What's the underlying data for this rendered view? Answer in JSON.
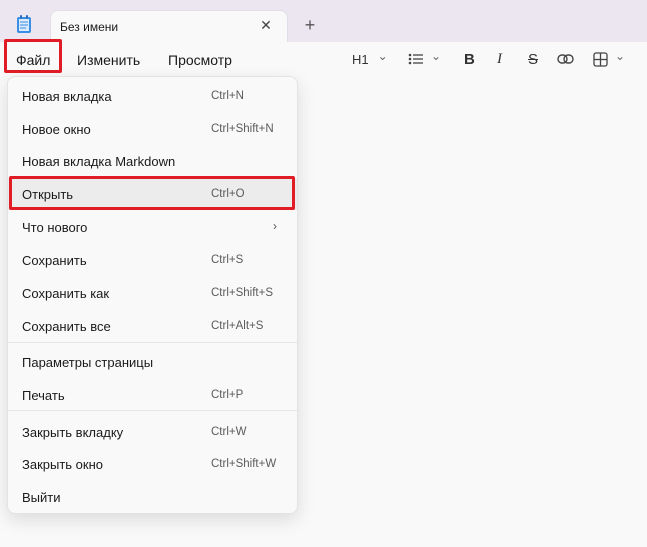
{
  "window": {
    "tab_title": "Без имени",
    "tab_close": "✕",
    "new_tab": "+"
  },
  "menubar": {
    "file": "Файл",
    "edit": "Изменить",
    "view": "Просмотр"
  },
  "toolbar": {
    "heading": "H1",
    "heading_chevron": "⌄",
    "list_chevron": "⌄",
    "bold": "B",
    "italic": "I",
    "strike": "S",
    "table_chevron": "⌄"
  },
  "file_menu": {
    "items": [
      {
        "label": "Новая вкладка",
        "shortcut": "Ctrl+N"
      },
      {
        "label": "Новое окно",
        "shortcut": "Ctrl+Shift+N"
      },
      {
        "label": "Новая вкладка Markdown",
        "shortcut": ""
      },
      {
        "label": "Открыть",
        "shortcut": "Ctrl+O"
      },
      {
        "label": "Что нового",
        "shortcut": "",
        "submenu": "›"
      },
      {
        "label": "Сохранить",
        "shortcut": "Ctrl+S"
      },
      {
        "label": "Сохранить как",
        "shortcut": "Ctrl+Shift+S"
      },
      {
        "label": "Сохранить все",
        "shortcut": "Ctrl+Alt+S"
      },
      {
        "label": "Параметры страницы",
        "shortcut": ""
      },
      {
        "label": "Печать",
        "shortcut": "Ctrl+P"
      },
      {
        "label": "Закрыть вкладку",
        "shortcut": "Ctrl+W"
      },
      {
        "label": "Закрыть окно",
        "shortcut": "Ctrl+Shift+W"
      },
      {
        "label": "Выйти",
        "shortcut": ""
      }
    ]
  },
  "colors": {
    "highlight": "#e01d27",
    "titlebar": "#ece6f0",
    "surface": "#f9f9f9"
  }
}
